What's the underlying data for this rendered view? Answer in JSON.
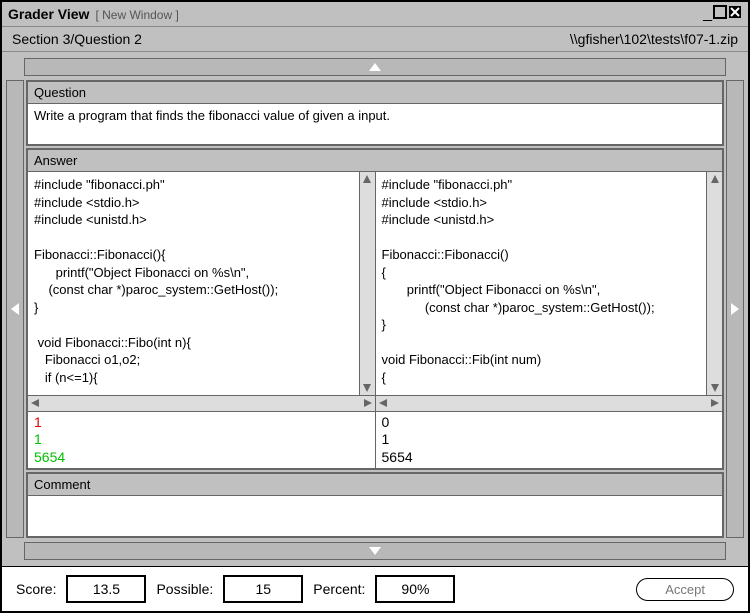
{
  "window": {
    "title": "Grader View",
    "new_window": "[ New Window ]",
    "breadcrumb": "Section 3/Question 2",
    "filepath": "\\\\gfisher\\102\\tests\\f07-1.zip"
  },
  "question": {
    "header": "Question",
    "text": "Write a program that finds the fibonacci  value of given a input."
  },
  "answer": {
    "header": "Answer",
    "left_code": "#include \"fibonacci.ph\"\n#include <stdio.h>\n#include <unistd.h>\n\nFibonacci::Fibonacci(){\n      printf(\"Object Fibonacci on %s\\n\",\n    (const char *)paroc_system::GetHost());\n}\n\n void Fibonacci::Fibo(int n){\n   Fibonacci o1,o2;\n   if (n<=1){",
    "right_code": "#include \"fibonacci.ph\"\n#include <stdio.h>\n#include <unistd.h>\n\nFibonacci::Fibonacci()\n{\n       printf(\"Object Fibonacci on %s\\n\",\n            (const char *)paroc_system::GetHost());\n}\n\nvoid Fibonacci::Fib(int num)\n{",
    "left_output": {
      "l1": "1",
      "l2": "1",
      "l3": "5654"
    },
    "right_output": {
      "l1": "0",
      "l2": "1",
      "l3": "5654"
    }
  },
  "comment": {
    "header": "Comment",
    "text": ""
  },
  "footer": {
    "score_label": "Score:",
    "score_value": "13.5",
    "possible_label": "Possible:",
    "possible_value": "15",
    "percent_label": "Percent:",
    "percent_value": "90%",
    "accept_label": "Accept"
  }
}
